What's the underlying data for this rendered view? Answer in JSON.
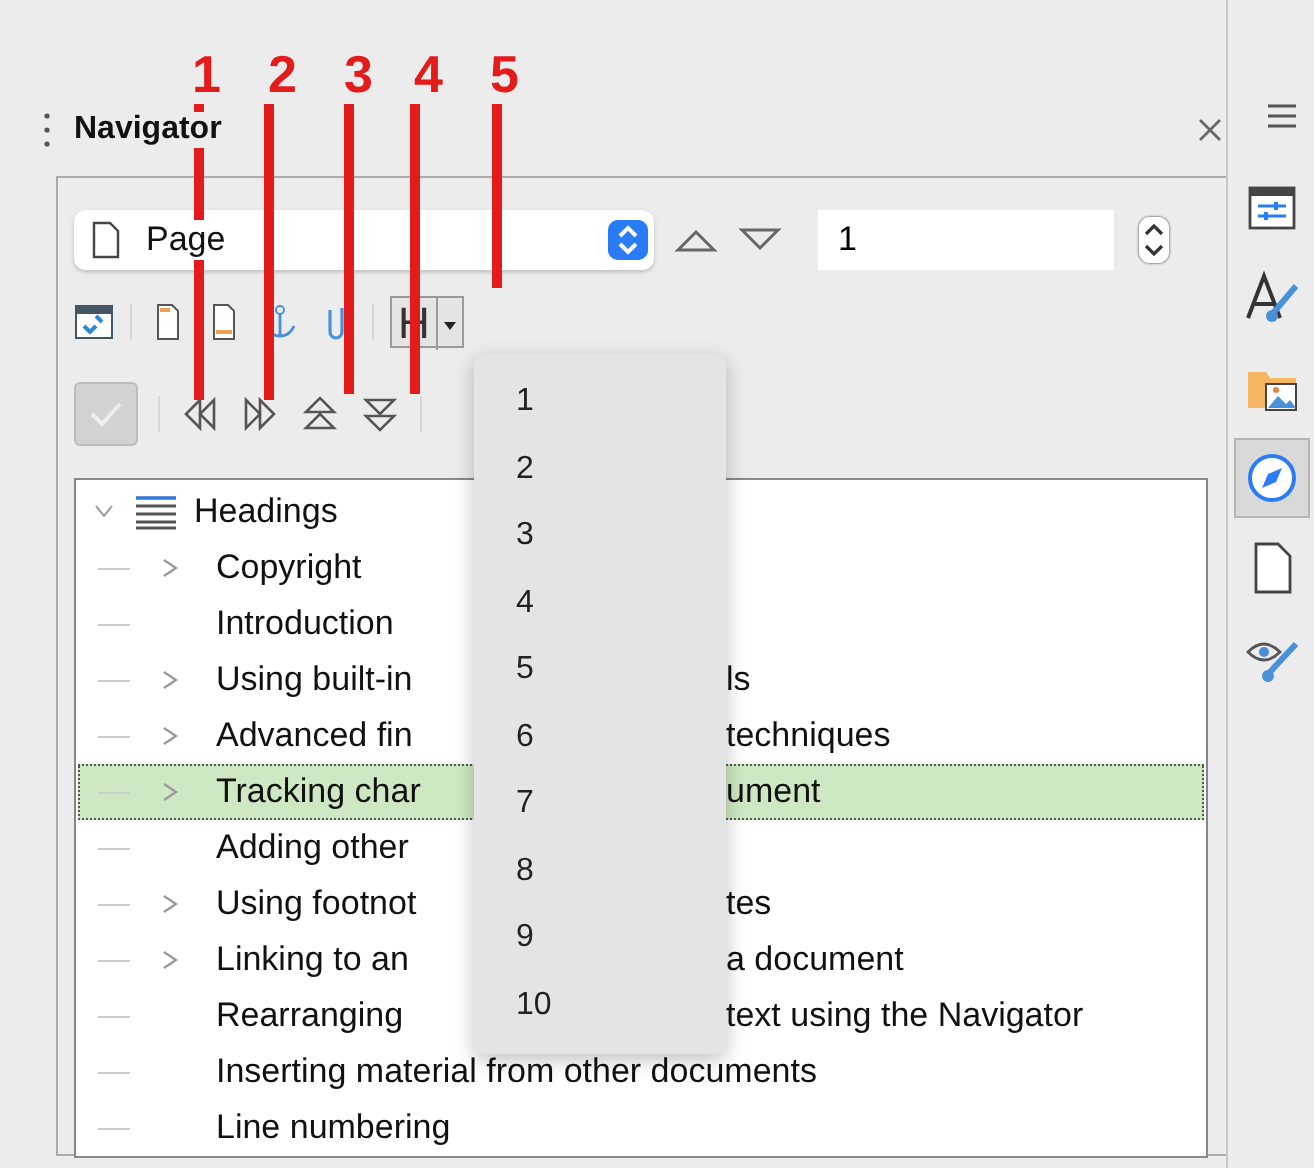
{
  "panel": {
    "title": "Navigator"
  },
  "type_select": {
    "value": "Page"
  },
  "page_field": {
    "value": "1"
  },
  "heading_level_button": {
    "label": "H"
  },
  "heading_menu": {
    "items": [
      "1",
      "2",
      "3",
      "4",
      "5",
      "6",
      "7",
      "8",
      "9",
      "10"
    ]
  },
  "tree": {
    "label": "Headings",
    "expanded": true,
    "children": [
      {
        "text": "Copyright",
        "has_children": true,
        "selected": false
      },
      {
        "text": "Introduction",
        "has_children": false,
        "selected": false
      },
      {
        "text": "Using built-in",
        "tail": "ls",
        "has_children": true,
        "selected": false
      },
      {
        "text": "Advanced fin",
        "tail": "techniques",
        "has_children": true,
        "selected": false
      },
      {
        "text": "Tracking char",
        "tail": "ument",
        "has_children": true,
        "selected": true
      },
      {
        "text": "Adding other",
        "has_children": false,
        "selected": false
      },
      {
        "text": "Using footnot",
        "tail": "tes",
        "has_children": true,
        "selected": false
      },
      {
        "text": "Linking to an",
        "tail": "a document",
        "has_children": true,
        "selected": false
      },
      {
        "text": "Rearranging",
        "tail": "text using the Navigator",
        "has_children": false,
        "selected": false
      },
      {
        "text": "Inserting material from other documents",
        "has_children": false,
        "selected": false
      },
      {
        "text": "Line numbering",
        "has_children": false,
        "selected": false
      }
    ]
  },
  "sidebar_tabs": [
    {
      "kind": "properties",
      "selected": false
    },
    {
      "kind": "styles",
      "selected": false
    },
    {
      "kind": "gallery",
      "selected": false
    },
    {
      "kind": "navigator",
      "selected": true
    },
    {
      "kind": "page",
      "selected": false
    },
    {
      "kind": "inspector",
      "selected": false
    }
  ],
  "callouts": [
    {
      "label": "1"
    },
    {
      "label": "2"
    },
    {
      "label": "3"
    },
    {
      "label": "4"
    },
    {
      "label": "5"
    }
  ]
}
